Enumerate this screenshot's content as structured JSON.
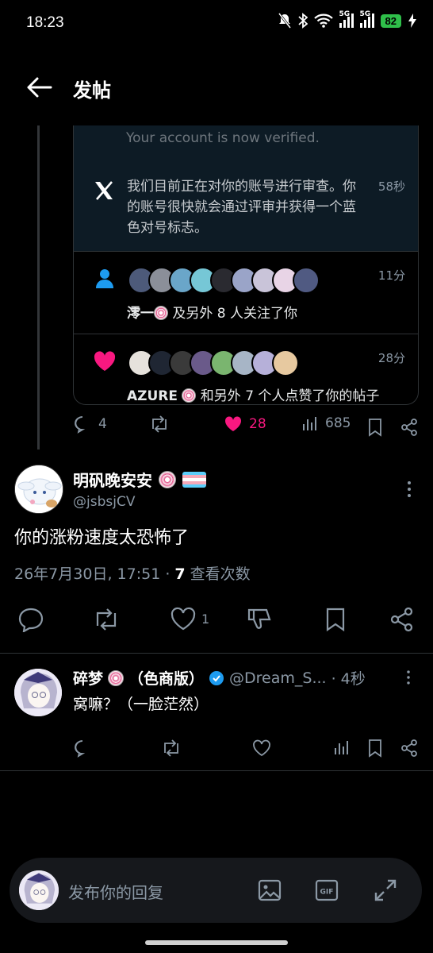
{
  "status_bar": {
    "time": "18:23",
    "battery": "82",
    "net1": "5G",
    "net2": "5G"
  },
  "header": {
    "title": "发帖"
  },
  "quoted_card": {
    "verified_line": "Your account is now verified.",
    "notification": {
      "text": "我们目前正在对你的账号进行审查。你的账号很快就会通过评审并获得一个蓝色对号标志。",
      "time": "58秒"
    },
    "follow_row": {
      "name": "澪一",
      "rest": " 及另外 8 人关注了你",
      "time": "11分"
    },
    "like_row": {
      "name": "AZURE",
      "rest": " 和另外 7 个人点赞了你的帖子",
      "time": "28分"
    }
  },
  "quoted_actions": {
    "replies": "4",
    "likes": "28",
    "views": "685"
  },
  "main_tweet": {
    "name": "明矾晚安安",
    "handle": "@jsbsjCV",
    "text": "你的涨粉速度太恐怖了",
    "date": "26年7月30日, 17:51 · ",
    "views_count": "7",
    "views_label": " 查看次数",
    "likes": "1"
  },
  "reply": {
    "name": "碎梦",
    "name_suffix": "（色商版）",
    "handle": "@Dream_S...",
    "time": "· 4秒",
    "text": "窝嘛？（一脸茫然）"
  },
  "composer": {
    "placeholder": "发布你的回复"
  },
  "colors": {
    "like_pink": "#f91880",
    "verified_blue": "#1d9bf0",
    "notif_bg": "#0d1b25",
    "follow_blue": "#1d9bf0"
  }
}
